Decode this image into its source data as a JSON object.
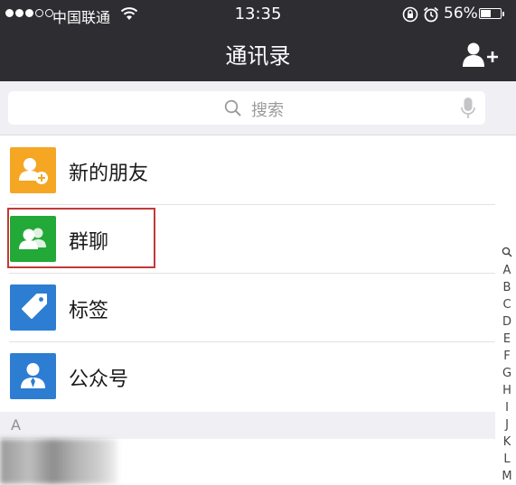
{
  "status_bar": {
    "carrier": "中国联通",
    "time": "13:35",
    "battery": "56%",
    "battery_level": 0.56
  },
  "nav": {
    "title": "通讯录",
    "add_icon": "add-friend-icon"
  },
  "search": {
    "placeholder": "搜索",
    "icons": [
      "search-icon",
      "microphone-icon"
    ]
  },
  "list": {
    "items": [
      {
        "label": "新的朋友",
        "icon": "new-friend-icon",
        "color": "#f5a623"
      },
      {
        "label": "群聊",
        "icon": "group-chat-icon",
        "color": "#22a938"
      },
      {
        "label": "标签",
        "icon": "tag-icon",
        "color": "#2d7dd2"
      },
      {
        "label": "公众号",
        "icon": "official-account-icon",
        "color": "#2d7dd2"
      }
    ],
    "section": "A"
  },
  "index": [
    "A",
    "B",
    "C",
    "D",
    "E",
    "F",
    "G",
    "H",
    "I",
    "J",
    "K",
    "L",
    "M"
  ],
  "colors": {
    "nav_bg": "#2e2d32",
    "highlight": "#c03a39",
    "search_bg": "#efeff4"
  }
}
